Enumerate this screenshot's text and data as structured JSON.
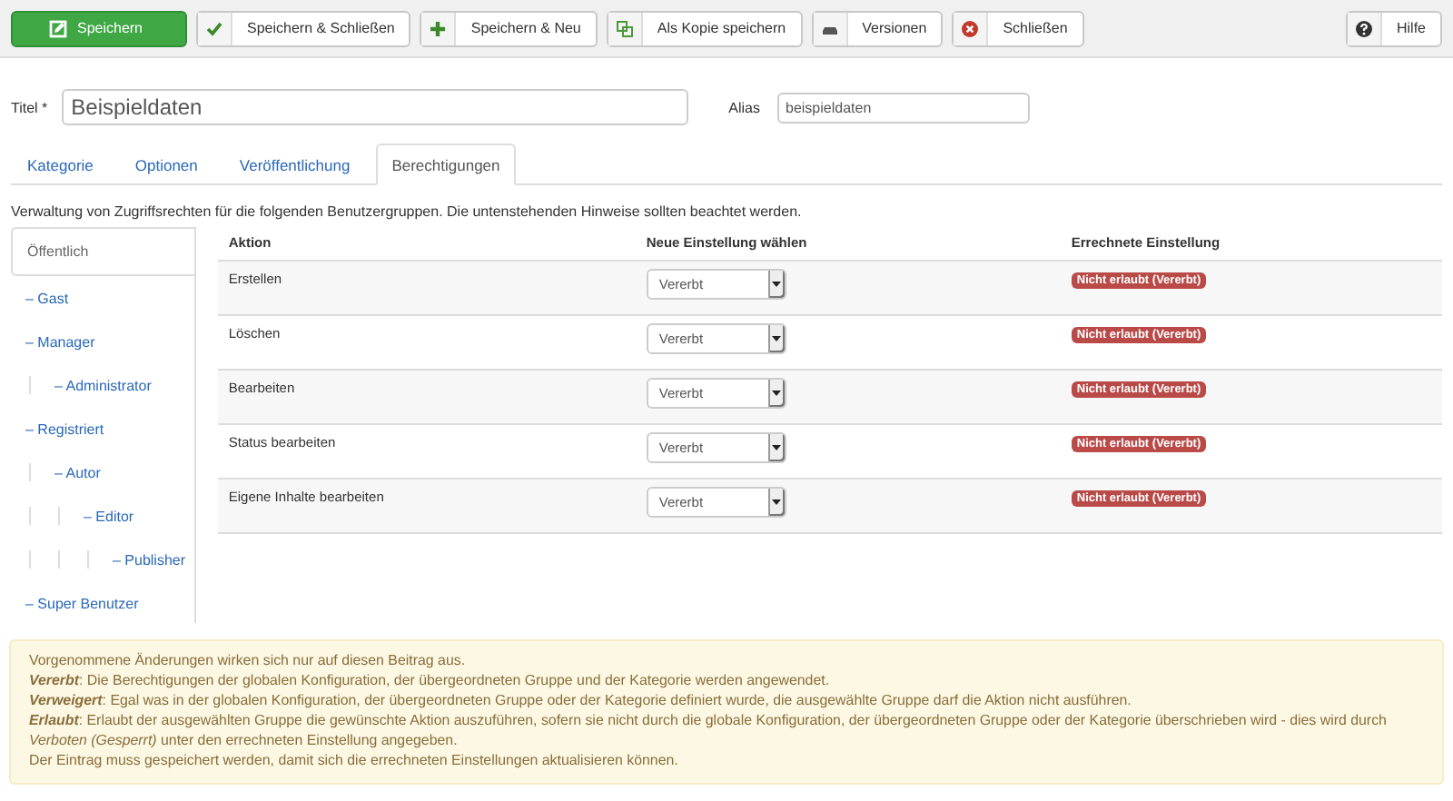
{
  "toolbar": {
    "buttons": [
      {
        "label": "Speichern",
        "kind": "save",
        "primary": true
      },
      {
        "label": "Speichern & Schließen",
        "kind": "check",
        "primary": false
      },
      {
        "label": "Speichern & Neu",
        "kind": "plus",
        "primary": false
      },
      {
        "label": "Als Kopie speichern",
        "kind": "copy",
        "primary": false
      },
      {
        "label": "Versionen",
        "kind": "archive",
        "primary": false
      },
      {
        "label": "Schließen",
        "kind": "close",
        "primary": false
      }
    ],
    "help": {
      "label": "Hilfe",
      "kind": "help",
      "primary": false
    }
  },
  "form": {
    "title_label": "Titel *",
    "title_value": "Beispieldaten",
    "alias_label": "Alias",
    "alias_value": "beispieldaten"
  },
  "tabs": [
    {
      "label": "Kategorie",
      "selected": false
    },
    {
      "label": "Optionen",
      "selected": false
    },
    {
      "label": "Veröffentlichung",
      "selected": false
    },
    {
      "label": "Berechtigungen",
      "selected": true
    }
  ],
  "description": "Verwaltung von Zugriffsrechten für die folgenden Benutzergruppen. Die untenstehenden Hinweise sollten beachtet werden.",
  "groups": [
    {
      "label": "Öffentlich",
      "selected": true,
      "children": [
        {
          "label": "– Gast",
          "selected": false
        },
        {
          "label": "– Manager",
          "selected": false,
          "children": [
            {
              "label": "– Administrator",
              "selected": false
            }
          ]
        },
        {
          "label": "– Registriert",
          "selected": false,
          "children": [
            {
              "label": "– Autor",
              "selected": false,
              "children": [
                {
                  "label": "– Editor",
                  "selected": false,
                  "children": [
                    {
                      "label": "– Publisher",
                      "selected": false
                    }
                  ]
                }
              ]
            }
          ]
        },
        {
          "label": "– Super Benutzer",
          "selected": false
        }
      ]
    }
  ],
  "table": {
    "columns": [
      "Aktion",
      "Neue Einstellung wählen",
      "Errechnete Einstellung"
    ],
    "rows": [
      {
        "action": "Erstellen",
        "setting": "Vererbt",
        "result": "Nicht erlaubt (Vererbt)"
      },
      {
        "action": "Löschen",
        "setting": "Vererbt",
        "result": "Nicht erlaubt (Vererbt)"
      },
      {
        "action": "Bearbeiten",
        "setting": "Vererbt",
        "result": "Nicht erlaubt (Vererbt)"
      },
      {
        "action": "Status bearbeiten",
        "setting": "Vererbt",
        "result": "Nicht erlaubt (Vererbt)"
      },
      {
        "action": "Eigene Inhalte bearbeiten",
        "setting": "Vererbt",
        "result": "Nicht erlaubt (Vererbt)"
      }
    ]
  },
  "notice": [
    "Vorgenommene Änderungen wirken sich nur auf diesen Beitrag aus.",
    "**Vererbt**: Die Berechtigungen der globalen Konfiguration, der übergeordneten Gruppe und der Kategorie werden angewendet.",
    "**Verweigert**: Egal was in der globalen Konfiguration, der übergeordneten Gruppe oder der Kategorie definiert wurde, die ausgewählte Gruppe darf die Aktion nicht ausführen.",
    "**Erlaubt**: Erlaubt der ausgewählten Gruppe die gewünschte Aktion auszuführen, sofern sie nicht durch die globale Konfiguration, der übergeordneten Gruppe oder der Kategorie überschrieben wird - dies wird durch *Verboten (Gesperrt)* unter den errechneten Einstellung angegeben.",
    "Der Eintrag muss gespeichert werden, damit sich die errechneten Einstellungen aktualisieren können."
  ]
}
